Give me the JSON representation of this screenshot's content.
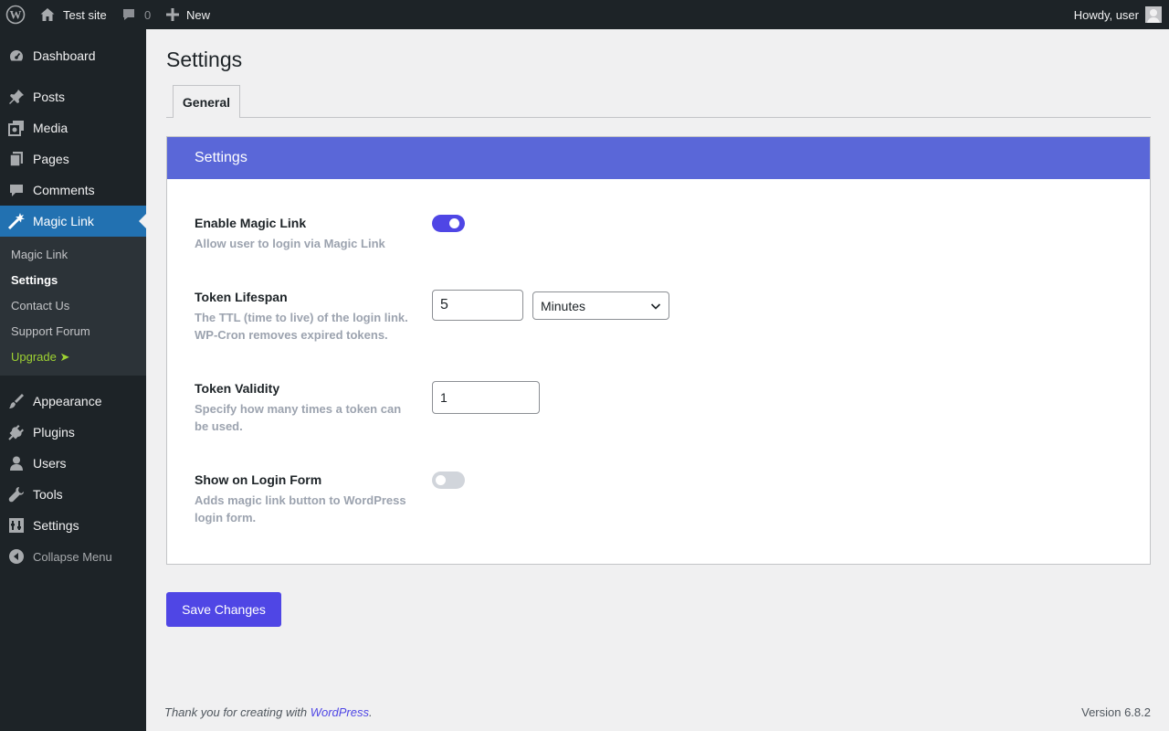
{
  "adminbar": {
    "site_name": "Test site",
    "comments_count": "0",
    "new_label": "New",
    "howdy": "Howdy, user"
  },
  "sidebar": {
    "items": [
      {
        "label": "Dashboard",
        "icon": "dashboard-icon"
      },
      {
        "label": "Posts",
        "icon": "pin-icon"
      },
      {
        "label": "Media",
        "icon": "media-icon"
      },
      {
        "label": "Pages",
        "icon": "pages-icon"
      },
      {
        "label": "Comments",
        "icon": "comment-icon"
      },
      {
        "label": "Magic Link",
        "icon": "wand-icon",
        "active": true
      },
      {
        "label": "Appearance",
        "icon": "brush-icon"
      },
      {
        "label": "Plugins",
        "icon": "plugin-icon"
      },
      {
        "label": "Users",
        "icon": "user-icon"
      },
      {
        "label": "Tools",
        "icon": "wrench-icon"
      },
      {
        "label": "Settings",
        "icon": "settings-icon"
      }
    ],
    "submenu": [
      {
        "label": "Magic Link"
      },
      {
        "label": "Settings",
        "current": true
      },
      {
        "label": "Contact Us"
      },
      {
        "label": "Support Forum"
      },
      {
        "label": "Upgrade ➤"
      }
    ],
    "collapse_label": "Collapse Menu"
  },
  "main": {
    "title": "Settings",
    "tab_label": "General",
    "panel_title": "Settings",
    "rows": {
      "enable": {
        "label": "Enable Magic Link",
        "desc": "Allow user to login via Magic Link",
        "enabled": true
      },
      "lifespan": {
        "label": "Token Lifespan",
        "desc": "The TTL (time to live) of the login link. WP-Cron removes expired tokens.",
        "value": "5",
        "unit": "Minutes"
      },
      "validity": {
        "label": "Token Validity",
        "desc": "Specify how many times a token can be used.",
        "value": "1"
      },
      "login_form": {
        "label": "Show on Login Form",
        "desc": "Adds magic link button to WordPress login form.",
        "enabled": false
      }
    },
    "save_label": "Save Changes"
  },
  "footer": {
    "thanks_prefix": "Thank you for creating with ",
    "thanks_link": "WordPress",
    "thanks_suffix": ".",
    "version": "Version 6.8.2"
  },
  "colors": {
    "accent": "#4f46e5",
    "panel_header": "#5a67d8",
    "wp_active": "#2271b1"
  }
}
